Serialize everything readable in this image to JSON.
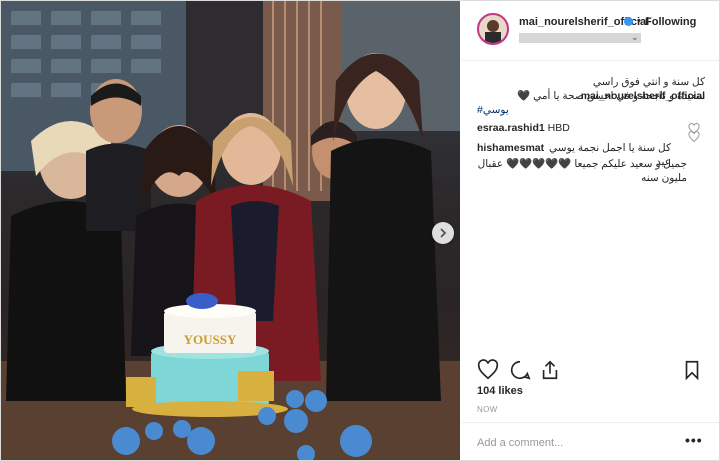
{
  "post": {
    "photo_alt": "Group of women celebrating around a birthday cake",
    "cake_text": "YOUSSY"
  },
  "header": {
    "username": "mai_nourelsherif_official",
    "separator": "•",
    "follow_label": "Following"
  },
  "comments": [
    {
      "user": "mai_nourelsherif_official",
      "line1": "كل سنة و انتي فوق راسي",
      "line2": "سعيدة و ناجحة و في احسن صحة يا أمي 🖤",
      "hashtag": "#يوسي"
    },
    {
      "user": "esraa.rashid1",
      "text": "HBD"
    },
    {
      "user": "hishamesmat",
      "line1": "كل سنة يا اجمل نجمة يوسي عيد",
      "line2": "جميل و سعيد عليكم جميعا 🖤🖤🖤🖤🖤 عقبال مليون سنه"
    }
  ],
  "icons": [
    "heart-icon",
    "comment-icon",
    "share-icon",
    "bookmark-icon",
    "verified-icon",
    "chevron-right-icon"
  ],
  "likes": "104 likes",
  "time": "NOW",
  "add_comment_placeholder": "Add a comment...",
  "more_label": "•••",
  "colors": {
    "link": "#003569",
    "verified": "#3897f0",
    "muted": "#999999"
  }
}
